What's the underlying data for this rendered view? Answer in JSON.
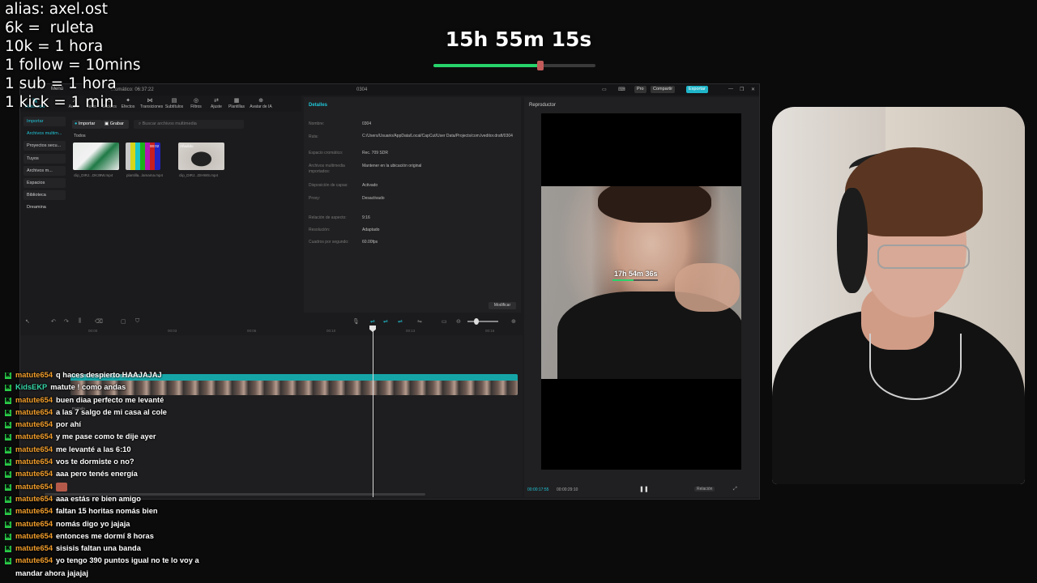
{
  "overlay": {
    "rules": [
      "alias: axel.ost",
      "6k =  ruleta",
      "10k = 1 hora",
      "1 follow = 10mins",
      "1 sub = 1 hora",
      "1 kick = 1 min"
    ],
    "timer": "15h 55m 15s",
    "timer_progress_percent": 66
  },
  "editor": {
    "title": "0304",
    "menu_label": "Menú",
    "autosave": "...omático: 06:37:22",
    "pro_label": "Pro",
    "share_label": "Compartir",
    "export_label": "Exportar",
    "tools": [
      "Multimedia",
      "Audio",
      "Texto",
      "Stickers",
      "Efectos",
      "Transiciones",
      "Subtítulos",
      "Filtros",
      "Ajuste",
      "Plantillas",
      "Avatar de IA"
    ],
    "sidebar": [
      "Importar",
      "Archivos multim...",
      "Proyectos secu...",
      "Tuyos",
      "Archivos m...",
      "Espacios",
      "Biblioteca",
      "Dreamina"
    ],
    "import_label": "Importar",
    "record_label": "Grabar",
    "search_placeholder": "Buscar archivos multimedia",
    "all_label": "Todos",
    "clips": [
      "clip_DIRJ...DK39W.mp4",
      "plantilla...lamama.mp4",
      "clip_DIRJ...DIHWS.mp4"
    ],
    "clip_badges": [
      "",
      "00:02",
      "Añadido"
    ],
    "details": {
      "header": "Detalles",
      "rows": [
        {
          "label": "Nombre:",
          "value": "0304"
        },
        {
          "label": "Ruta:",
          "value": "C:/Users/Usuario/AppData/Local/CapCut/User Data/Projects/com.lveditor.draft/0304"
        },
        {
          "label": "Espacio cromático:",
          "value": "Rec. 709 SDR"
        },
        {
          "label": "Archivos multimedia importados:",
          "value": "Mantener en la ubicación original"
        },
        {
          "label": "Disposición de capas:",
          "value": "Activado"
        },
        {
          "label": "Proxy:",
          "value": "Desactivado"
        },
        {
          "label": "Relación de aspecto:",
          "value": "9:16"
        },
        {
          "label": "Resolución:",
          "value": "Adaptado"
        },
        {
          "label": "Cuadros por segundo:",
          "value": "60.00fps"
        }
      ],
      "modify_label": "Modificar"
    },
    "player": {
      "header": "Reproductor",
      "current_time": "00:00:17:55",
      "total_time": "00:00:29:10",
      "ratio_label": "Relación",
      "overlay_timer": "17h 54m 36s"
    },
    "timeline": {
      "ruler": [
        "00:00",
        "00:03",
        "00:06",
        "00:10",
        "00:13",
        "00:16",
        "00:20"
      ],
      "clip_caption": "clip_DIRJ...DIHWS.mp4  00:00:29:10",
      "sub_caption": "Portada"
    }
  },
  "chat": [
    {
      "user": "matute654",
      "text": "q haces despierto HAAJAJAJ",
      "teal": false
    },
    {
      "user": "KidsEKP",
      "text": "matute ! como andas",
      "teal": true
    },
    {
      "user": "matute654",
      "text": "buen diaa perfecto me levanté",
      "teal": false
    },
    {
      "user": "matute654",
      "text": "a las 7 salgo de mi casa al cole",
      "teal": false
    },
    {
      "user": "matute654",
      "text": "por ahí",
      "teal": false
    },
    {
      "user": "matute654",
      "text": "y me pase como te dije ayer",
      "teal": false
    },
    {
      "user": "matute654",
      "text": "me levanté a las 6:10",
      "teal": false
    },
    {
      "user": "matute654",
      "text": "vos te dormiste o no?",
      "teal": false
    },
    {
      "user": "matute654",
      "text": "aaa pero tenés energía",
      "teal": false
    },
    {
      "user": "matute654",
      "text": "",
      "teal": false,
      "emote": true
    },
    {
      "user": "matute654",
      "text": "aaa estás re bien amigo",
      "teal": false
    },
    {
      "user": "matute654",
      "text": "faltan 15 horitas nomás bien",
      "teal": false
    },
    {
      "user": "matute654",
      "text": "nomás digo yo jajaja",
      "teal": false
    },
    {
      "user": "matute654",
      "text": "entonces me dormí 8 horas",
      "teal": false
    },
    {
      "user": "matute654",
      "text": "sisisis faltan una banda",
      "teal": false
    },
    {
      "user": "matute654",
      "text": "yo tengo 390 puntos igual no te lo voy a mandar ahora jajajaj",
      "teal": false
    }
  ],
  "colors": {
    "accent": "#20c6d8",
    "kick_green": "#2bd44b",
    "chat_user": "#f29e2b",
    "timer_bar": "#27d36a"
  }
}
